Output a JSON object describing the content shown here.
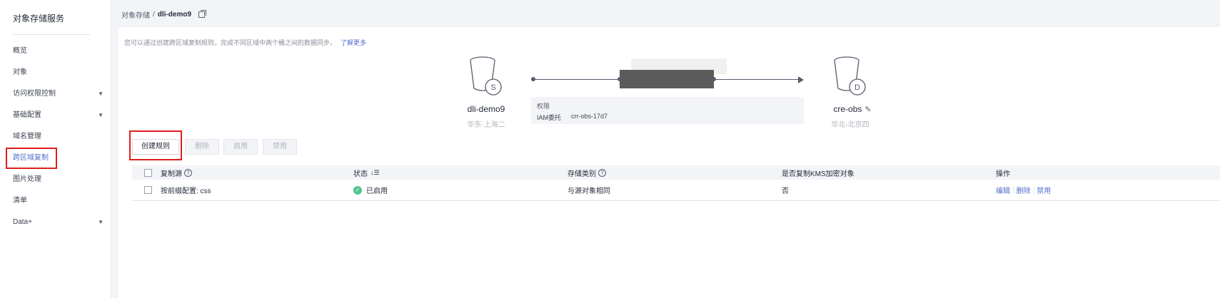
{
  "sidebar": {
    "title": "对象存储服务",
    "items": [
      {
        "label": "概览"
      },
      {
        "label": "对象"
      },
      {
        "label": "访问权限控制",
        "caret": "▼"
      },
      {
        "label": "基础配置",
        "caret": "▼"
      },
      {
        "label": "域名管理"
      },
      {
        "label": "跨区域复制"
      },
      {
        "label": "图片处理"
      },
      {
        "label": "清单"
      },
      {
        "label": "Data+",
        "caret": "▼"
      }
    ]
  },
  "breadcrumb": {
    "parent": "对象存储",
    "separator": "/",
    "current": "dli-demo9"
  },
  "tip": {
    "text": "您可以通过创建跨区域复制规则，完成不同区域中两个桶之间的数据同步。",
    "link": "了解更多"
  },
  "source_bucket": {
    "badge": "S",
    "name": "dli-demo9",
    "region": "华东-上海二"
  },
  "target_bucket": {
    "badge": "D",
    "name": "cre-obs",
    "region": "华北-北京四"
  },
  "permission": {
    "title": "权限",
    "label": "IAM委托",
    "value": "crr-obs-17d7"
  },
  "toolbar": {
    "create": "创建规则",
    "delete": "删除",
    "enable": "启用",
    "disable": "禁用"
  },
  "table": {
    "headers": {
      "source": "复制源",
      "status": "状态",
      "storage": "存储类别",
      "kms": "是否复制KMS加密对象",
      "ops": "操作"
    },
    "status_sort_icon": "↓☰",
    "rows": [
      {
        "source": "按前缀配置: css",
        "status": "已启用",
        "storage": "与源对象相同",
        "kms": "否",
        "op_edit": "编辑",
        "op_delete": "删除",
        "op_disable": "禁用"
      }
    ]
  },
  "colors": {
    "accent": "#526ecc",
    "highlight": "#e11d1d",
    "status_ok": "#50c58f"
  }
}
